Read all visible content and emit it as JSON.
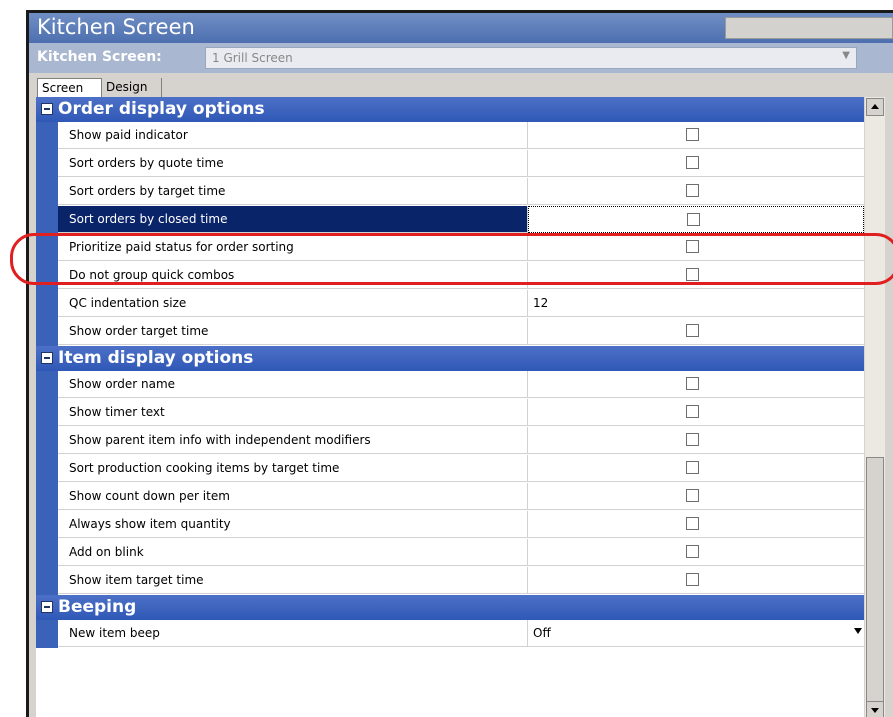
{
  "window": {
    "title": "Kitchen Screen"
  },
  "selector": {
    "label": "Kitchen Screen:",
    "value": "1 Grill Screen",
    "dropdown_icon": "chevron-down-icon"
  },
  "tabs": [
    {
      "label": "Screen",
      "active": true
    },
    {
      "label": "Design",
      "active": false
    }
  ],
  "sections": [
    {
      "title": "Order display options",
      "rows": [
        {
          "name": "Show paid indicator",
          "type": "checkbox",
          "checked": false
        },
        {
          "name": "Sort orders by quote time",
          "type": "checkbox",
          "checked": false
        },
        {
          "name": "Sort orders by target time",
          "type": "checkbox",
          "checked": false
        },
        {
          "name": "Sort orders by closed time",
          "type": "checkbox",
          "checked": false,
          "selected": true
        },
        {
          "name": "Prioritize paid status for order sorting",
          "type": "checkbox",
          "checked": false
        },
        {
          "name": "Do not group quick combos",
          "type": "checkbox",
          "checked": false
        },
        {
          "name": "QC indentation size",
          "type": "text",
          "value": "12"
        },
        {
          "name": "Show order target time",
          "type": "checkbox",
          "checked": false
        }
      ]
    },
    {
      "title": "Item display options",
      "rows": [
        {
          "name": "Show order name",
          "type": "checkbox",
          "checked": false
        },
        {
          "name": "Show timer text",
          "type": "checkbox",
          "checked": false
        },
        {
          "name": "Show parent item info with independent modifiers",
          "type": "checkbox",
          "checked": false
        },
        {
          "name": "Sort production cooking items by target time",
          "type": "checkbox",
          "checked": false
        },
        {
          "name": "Show count down per item",
          "type": "checkbox",
          "checked": false
        },
        {
          "name": "Always show item quantity",
          "type": "checkbox",
          "checked": false
        },
        {
          "name": "Add on blink",
          "type": "checkbox",
          "checked": false
        },
        {
          "name": "Show item target time",
          "type": "checkbox",
          "checked": false
        }
      ]
    },
    {
      "title": "Beeping",
      "rows": [
        {
          "name": "New item beep",
          "type": "dropdown",
          "value": "Off"
        }
      ]
    }
  ],
  "colors": {
    "section_header": "#2f58b6",
    "selected_row": "#0a246a",
    "highlight_ring": "#e02020"
  }
}
